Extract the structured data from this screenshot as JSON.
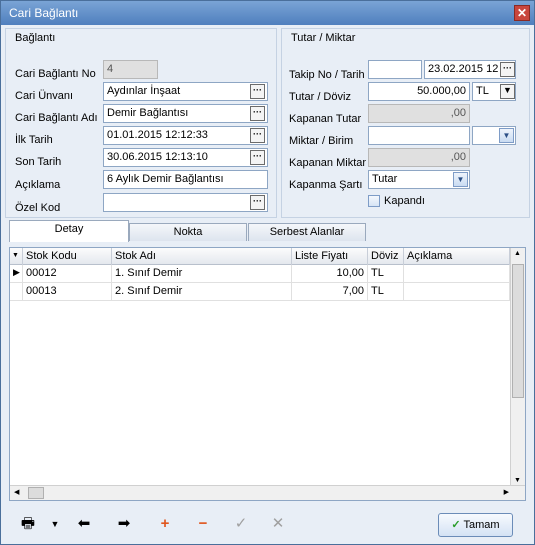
{
  "window": {
    "title": "Cari Bağlantı"
  },
  "baglanti": {
    "section_title": "Bağlantı",
    "no_label": "Cari Bağlantı No",
    "no_value": "4",
    "unvan_label": "Cari Ünvanı",
    "unvan_value": "Aydınlar İnşaat",
    "adi_label": "Cari Bağlantı Adı",
    "adi_value": "Demir Bağlantısı",
    "ilk_label": "İlk Tarih",
    "ilk_value": "01.01.2015 12:12:33",
    "son_label": "Son Tarih",
    "son_value": "30.06.2015 12:13:10",
    "aciklama_label": "Açıklama",
    "aciklama_value": "6 Aylık Demir Bağlantısı",
    "ozel_label": "Özel Kod",
    "ozel_value": ""
  },
  "tutar": {
    "section_title": "Tutar / Miktar",
    "takip_label": "Takip No / Tarih",
    "takip_no": "",
    "takip_tarih": "23.02.2015 12",
    "doviz_label": "Tutar / Döviz",
    "tutar_value": "50.000,00",
    "doviz_value": "TL",
    "kapanan_tutar_label": "Kapanan Tutar",
    "kapanan_tutar_value": ",00",
    "miktar_label": "Miktar / Birim",
    "miktar_value": "",
    "birim_value": "",
    "kapanan_miktar_label": "Kapanan Miktar",
    "kapanan_miktar_value": ",00",
    "kapanma_label": "Kapanma Şartı",
    "kapanma_value": "Tutar",
    "kapandi_label": "Kapandı"
  },
  "tabs": [
    {
      "label": "Detay"
    },
    {
      "label": "Nokta"
    },
    {
      "label": "Serbest Alanlar"
    }
  ],
  "grid": {
    "headers": [
      "Stok Kodu",
      "Stok Adı",
      "Liste Fiyatı",
      "Döviz",
      "Açıklama"
    ],
    "rows": [
      [
        "00012",
        "1. Sınıf Demir",
        "10,00",
        "TL",
        ""
      ],
      [
        "00013",
        "2. Sınıf Demir",
        "7,00",
        "TL",
        ""
      ]
    ]
  },
  "toolbar": {
    "ok_label": "Tamam"
  }
}
